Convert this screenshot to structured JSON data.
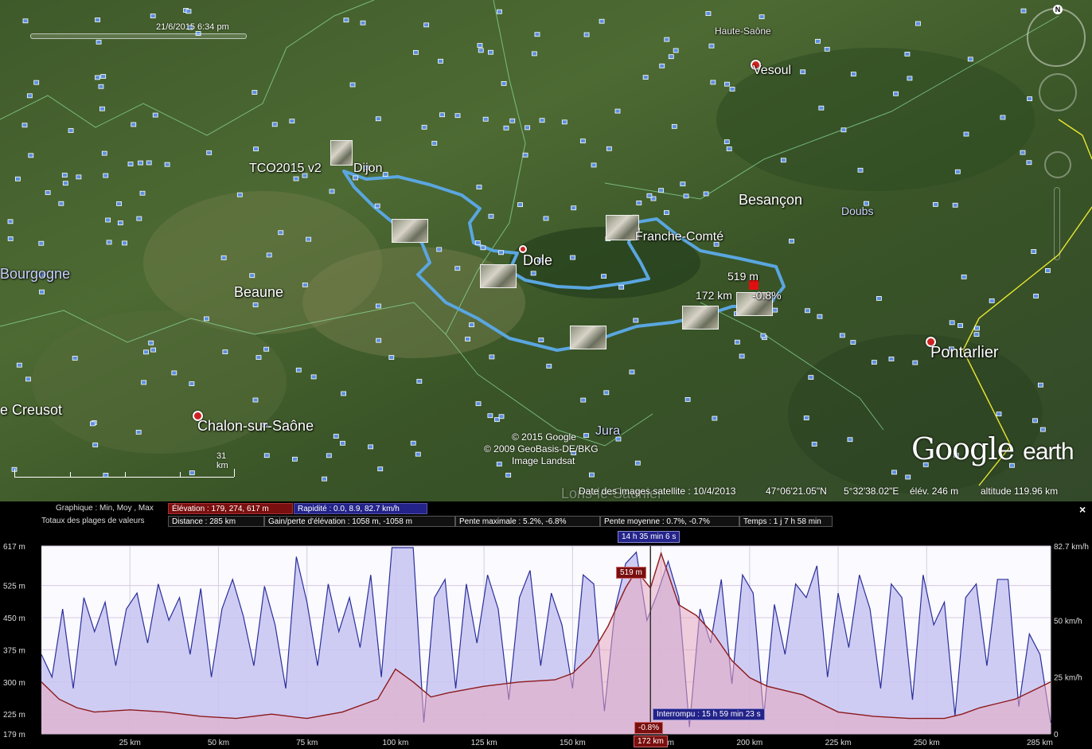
{
  "map": {
    "time_slider_date": "21/6/2015   6:34 pm",
    "tour_name": "TCO2015 v2",
    "labels": {
      "haute_saone": "Haute-Saône",
      "vesoul": "Vesoul",
      "dijon": "Dijon",
      "besancon": "Besançon",
      "doubs": "Doubs",
      "franche_comte": "Franche-Comté",
      "bourgogne": "Bourgogne",
      "dole": "Dole",
      "beaune": "Beaune",
      "pontarlier": "Pontarlier",
      "le_creusot": "e Creusot",
      "chalon": "Chalon-sur-Saône",
      "jura": "Jura",
      "lons": "Lons-le-Saunier"
    },
    "cursor_elevation": "519 m",
    "cursor_distance": "172 km",
    "cursor_slope": "-0.8%",
    "scale_label": "31  km",
    "credits": [
      "© 2015 Google",
      "© 2009 GeoBasis-DE/BKG",
      "Image Landsat"
    ],
    "imagery_date": "Date des images satellite : 10/4/2013",
    "lat": "47°06'21.05\"N",
    "lon": "5°32'38.02\"E",
    "elev": "élév.   246 m",
    "altitude": "altitude 119.96 km",
    "logo_google": "Google",
    "logo_earth": "earth",
    "compass_n": "N",
    "route_color": "#5aa6e0"
  },
  "panel": {
    "graph_label": "Graphique : Min, Moy , Max",
    "totals_label": "Totaux des plages de valeurs",
    "elevation_box": "Élévation : 179, 274, 617 m",
    "speed_box": "Rapidité : 0.0, 8.9, 82.7 km/h",
    "distance_box": "Distance : 285 km",
    "gain_box": "Gain/perte d'élévation : 1058 m, -1058 m",
    "slope_max_box": "Pente maximale : 5.2%, -6.8%",
    "slope_avg_box": "Pente moyenne : 0.7%, -0.7%",
    "time_box": "Temps : 1 j 7 h 58 min",
    "close_glyph": "×",
    "marker_time": "14 h 35 min 6 s",
    "marker_elev": "519 m",
    "marker_slope": "-0.8%",
    "marker_dist": "172 km",
    "marker_pause": "Interrompu : 15 h 59 min 23 s",
    "elev_color": "#8b1a1a",
    "speed_color": "#2b2f9a"
  },
  "chart_data": {
    "type": "area",
    "title": "",
    "x_unit": "km",
    "xlim": [
      0,
      285
    ],
    "x_ticks": [
      25,
      50,
      75,
      100,
      125,
      150,
      175,
      200,
      225,
      250,
      285
    ],
    "x_tick_labels": [
      "25 km",
      "50 km",
      "75 km",
      "100 km",
      "125 km",
      "150 km",
      "175 km",
      "200 km",
      "225 km",
      "250 km",
      "285 km"
    ],
    "left_axis": {
      "label": "",
      "ylim": [
        179,
        617
      ],
      "ticks": [
        179,
        225,
        300,
        375,
        450,
        525,
        617
      ],
      "tick_labels": [
        "179 m",
        "225 m",
        "300 m",
        "375 m",
        "450 m",
        "525 m",
        "617 m"
      ]
    },
    "right_axis": {
      "label": "",
      "ylim": [
        0,
        82.7
      ],
      "ticks": [
        0,
        25,
        50,
        82.7
      ],
      "tick_labels": [
        "0",
        "25 km/h",
        "50 km/h",
        "82.7 km/h"
      ]
    },
    "series": [
      {
        "name": "Élévation",
        "axis": "left",
        "x": [
          0,
          5,
          10,
          15,
          25,
          35,
          45,
          55,
          65,
          75,
          85,
          95,
          100,
          105,
          110,
          115,
          125,
          135,
          145,
          150,
          155,
          160,
          165,
          168,
          172,
          175,
          180,
          185,
          190,
          195,
          200,
          205,
          215,
          225,
          235,
          245,
          250,
          255,
          260,
          265,
          270,
          275,
          280,
          285
        ],
        "y": [
          300,
          260,
          240,
          230,
          235,
          230,
          220,
          215,
          225,
          215,
          230,
          260,
          330,
          300,
          265,
          275,
          290,
          300,
          305,
          320,
          360,
          430,
          520,
          560,
          519,
          600,
          480,
          455,
          410,
          350,
          310,
          290,
          270,
          230,
          220,
          215,
          215,
          215,
          225,
          240,
          250,
          260,
          280,
          300
        ]
      },
      {
        "name": "Rapidité",
        "axis": "right",
        "x": [
          0,
          3,
          6,
          9,
          12,
          15,
          18,
          21,
          24,
          27,
          30,
          33,
          36,
          39,
          42,
          45,
          48,
          51,
          54,
          57,
          60,
          63,
          66,
          69,
          72,
          75,
          78,
          81,
          84,
          87,
          90,
          93,
          96,
          99,
          102,
          105,
          108,
          111,
          114,
          117,
          120,
          123,
          126,
          129,
          132,
          135,
          138,
          141,
          144,
          147,
          150,
          153,
          156,
          159,
          162,
          165,
          168,
          171,
          174,
          177,
          180,
          183,
          186,
          189,
          192,
          195,
          198,
          201,
          204,
          207,
          210,
          213,
          216,
          219,
          222,
          225,
          228,
          231,
          234,
          237,
          240,
          243,
          246,
          249,
          252,
          255,
          258,
          261,
          264,
          267,
          270,
          273,
          276,
          279,
          282,
          285
        ],
        "y": [
          35,
          25,
          55,
          20,
          60,
          45,
          58,
          30,
          55,
          62,
          40,
          66,
          50,
          60,
          35,
          64,
          25,
          55,
          68,
          52,
          30,
          65,
          48,
          20,
          78,
          58,
          30,
          66,
          45,
          60,
          38,
          70,
          25,
          82,
          82,
          82,
          5,
          60,
          68,
          20,
          66,
          40,
          70,
          55,
          15,
          60,
          72,
          30,
          62,
          48,
          20,
          70,
          66,
          10,
          55,
          75,
          80,
          50,
          62,
          76,
          60,
          3,
          55,
          40,
          68,
          22,
          70,
          62,
          8,
          57,
          35,
          66,
          60,
          74,
          25,
          62,
          38,
          70,
          55,
          20,
          66,
          60,
          15,
          70,
          48,
          58,
          8,
          60,
          66,
          30,
          68,
          68,
          12,
          44,
          35,
          5
        ]
      }
    ]
  }
}
